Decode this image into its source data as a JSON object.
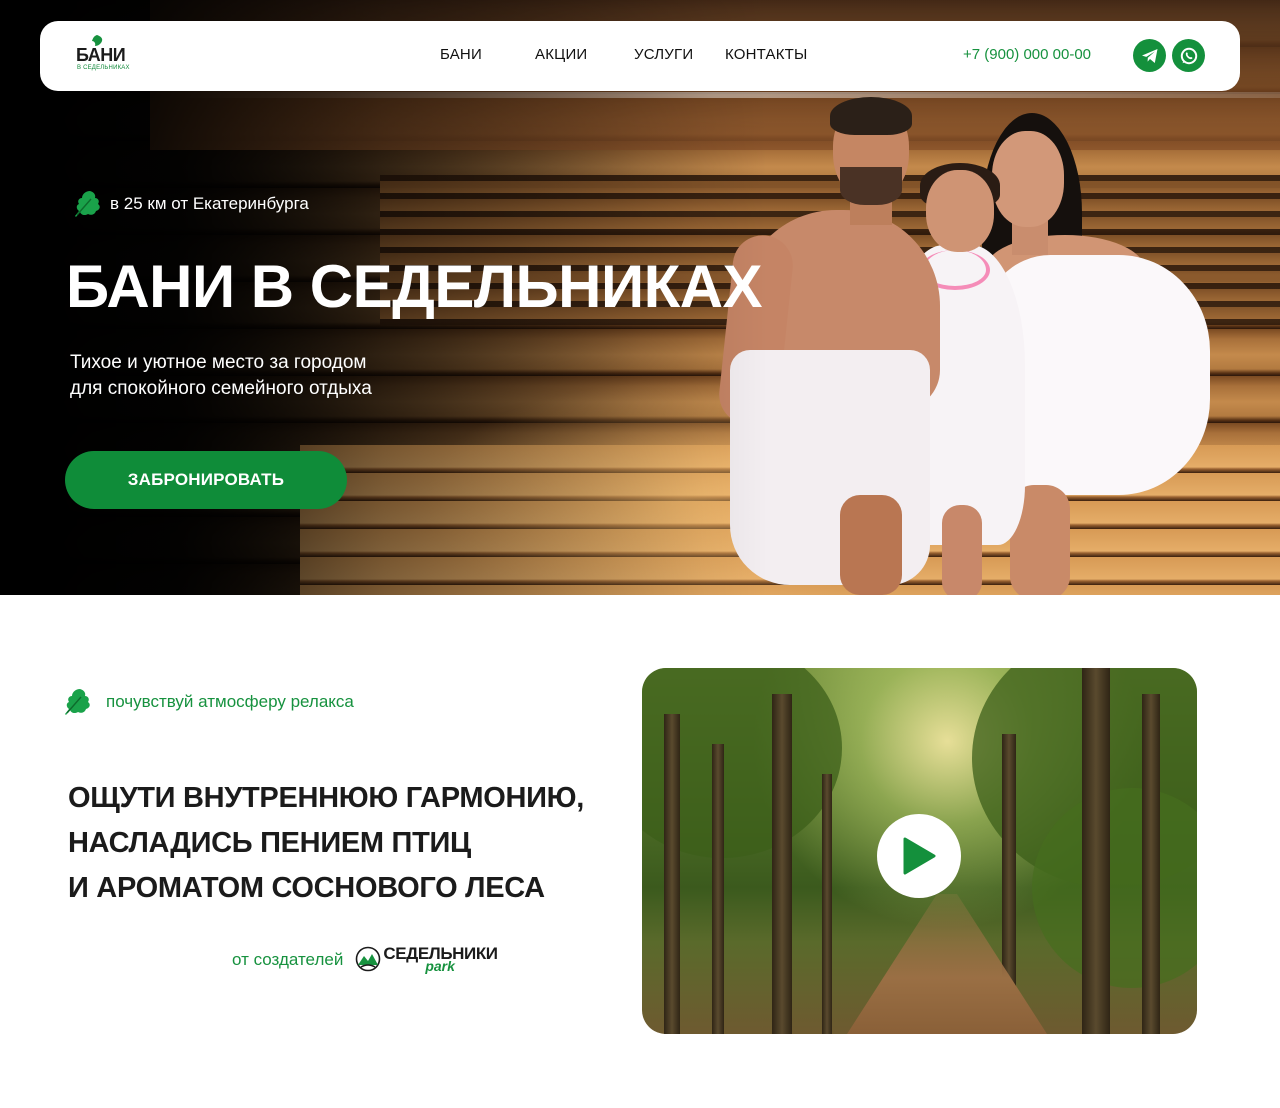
{
  "nav": {
    "logo_text": "БАНИ",
    "logo_sub": "В СЕДЕЛЬНИКАХ",
    "links": [
      "БАНИ",
      "АКЦИИ",
      "УСЛУГИ",
      "КОНТАКТЫ"
    ],
    "phone": "+7 (900) 000 00-00",
    "icons": [
      "telegram-icon",
      "whatsapp-icon"
    ]
  },
  "hero": {
    "tag": "в 25 км от Екатеринбурга",
    "title": "БАНИ В СЕДЕЛЬНИКАХ",
    "subtitle_line1": "Тихое и уютное место за городом",
    "subtitle_line2": "для спокойного семейного отдыха",
    "cta": "ЗАБРОНИРОВАТЬ"
  },
  "section2": {
    "tag": "почувствуй атмосферу релакса",
    "heading_line1": "ОЩУТИ ВНУТРЕННЮЮ ГАРМОНИЮ,",
    "heading_line2": "НАСЛАДИСЬ ПЕНИЕМ ПТИЦ",
    "heading_line3": "И АРОМАТОМ СОСНОВОГО ЛЕСА",
    "creators_text": "от создателей",
    "creators_logo_name": "СЕДЕЛЬНИКИ",
    "creators_logo_park": "park"
  },
  "colors": {
    "brand_green": "#0f8c39",
    "text_dark": "#1b1b1b",
    "white": "#ffffff"
  }
}
